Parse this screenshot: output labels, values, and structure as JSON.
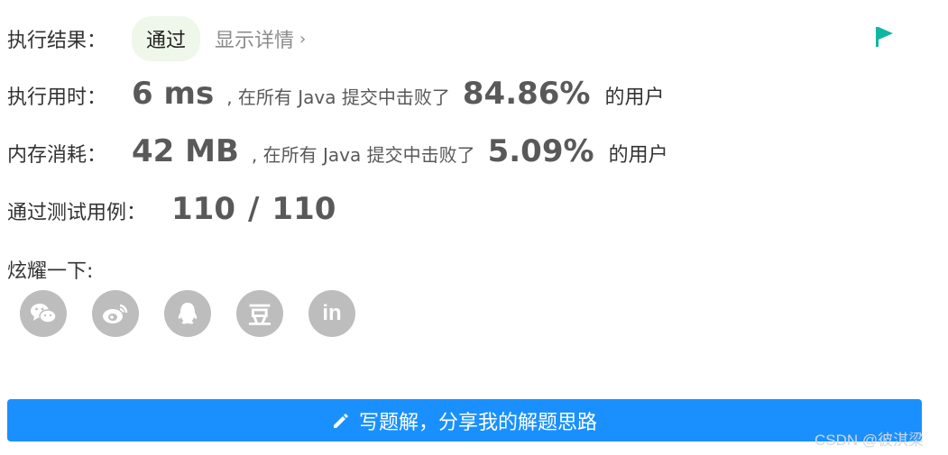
{
  "result": {
    "label": "执行结果：",
    "status": "通过",
    "details": "显示详情",
    "details_icon": "chevron-right-icon",
    "flag_icon": "flag-icon",
    "flag_color": "#10b7a2"
  },
  "runtime": {
    "label": "执行用时：",
    "value": "6 ms",
    "prefix": ", 在所有 Java 提交中击败了",
    "percent": "84.86%",
    "suffix": "的用户"
  },
  "memory": {
    "label": "内存消耗：",
    "value": "42 MB",
    "prefix": ", 在所有 Java 提交中击败了",
    "percent": "5.09%",
    "suffix": "的用户"
  },
  "tests": {
    "label": "通过测试用例：",
    "passed": "110",
    "separator": "/",
    "total": "110"
  },
  "share": {
    "label": "炫耀一下:",
    "items": [
      {
        "name": "wechat",
        "icon": "wechat-icon"
      },
      {
        "name": "weibo",
        "icon": "weibo-icon"
      },
      {
        "name": "qq",
        "icon": "qq-icon"
      },
      {
        "name": "douban",
        "icon": "douban-icon",
        "glyph": "豆"
      },
      {
        "name": "linkedin",
        "icon": "linkedin-icon",
        "glyph": "in"
      }
    ],
    "icon_bg": "#bdbdbd"
  },
  "write_button": {
    "label": "写题解，分享我的解题思路",
    "icon": "pencil-icon",
    "bg": "#1a90ff"
  },
  "watermark": "CSDN @彼淇梁"
}
